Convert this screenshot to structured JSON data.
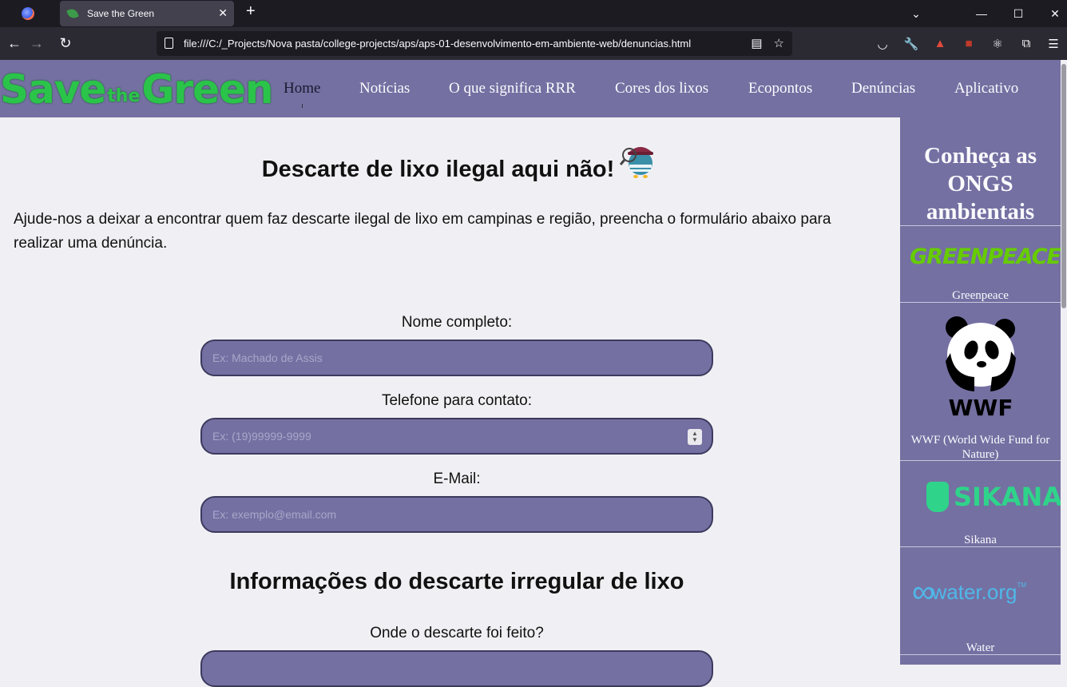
{
  "browser": {
    "tab_title": "Save the Green",
    "tab_close": "✕",
    "new_tab": "+",
    "url": "file:///C:/_Projects/Nova pasta/college-projects/aps/aps-01-desenvolvimento-em-ambiente-web/denuncias.html",
    "icons": {
      "back": "arrow-left-icon",
      "forward": "arrow-right-icon",
      "reload": "reload-icon"
    }
  },
  "logo": {
    "part1": "Save",
    "part2": "the",
    "part3": "Green"
  },
  "nav": [
    {
      "label": "Home"
    },
    {
      "label": "Notícias"
    },
    {
      "label": "O que significa RRR"
    },
    {
      "label": "Cores dos lixos"
    },
    {
      "label": "Ecopontos"
    },
    {
      "label": "Denúncias"
    },
    {
      "label": "Aplicativo"
    }
  ],
  "main": {
    "title": "Descarte de lixo ilegal aqui não!",
    "intro": "Ajude-nos a deixar a encontrar quem faz descarte ilegal de lixo em campinas e região, preencha o formulário abaixo para realizar uma denúncia.",
    "form": {
      "name_label": "Nome completo:",
      "name_placeholder": "Ex: Machado de Assis",
      "phone_label": "Telefone para contato:",
      "phone_placeholder": "Ex: (19)99999-9999",
      "email_label": "E-Mail:",
      "email_placeholder": "Ex: exemplo@email.com",
      "section_title": "Informações do descarte irregular de lixo",
      "location_label": "Onde o descarte foi feito?"
    }
  },
  "sidebar": {
    "title": "Conheça as ONGS ambientais",
    "orgs": [
      {
        "name": "Greenpeace",
        "logo_text": "GREENPEACE"
      },
      {
        "name": "WWF (World Wide Fund for Nature)",
        "logo_text": "WWF"
      },
      {
        "name": "Sikana",
        "logo_text": "SIKANA"
      },
      {
        "name": "Water",
        "logo_text": "water.org"
      }
    ]
  },
  "colors": {
    "header": "#7470a2",
    "logo_green": "#2bc44a",
    "page_bg": "#f0f0f4"
  }
}
